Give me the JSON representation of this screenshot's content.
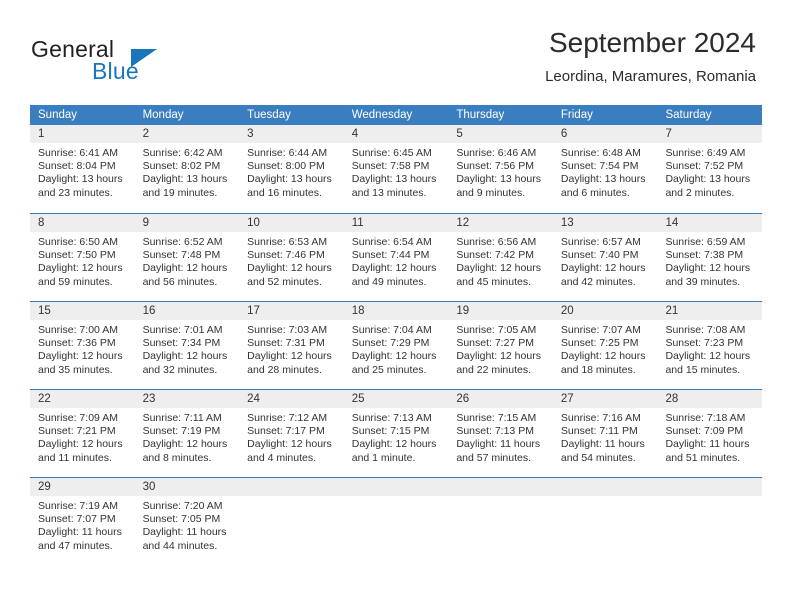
{
  "brand": {
    "name_part1": "General",
    "name_part2": "Blue",
    "logo_icon": "blue-triangle-icon"
  },
  "header": {
    "title": "September 2024",
    "subtitle": "Leordina, Maramures, Romania"
  },
  "colors": {
    "header_blue": "#3a7ebf",
    "brand_blue": "#1b75bb",
    "day_number_band": "#eeeeee",
    "text": "#333333"
  },
  "weekdays": [
    "Sunday",
    "Monday",
    "Tuesday",
    "Wednesday",
    "Thursday",
    "Friday",
    "Saturday"
  ],
  "weeks": [
    [
      {
        "day": "1",
        "sunrise": "Sunrise: 6:41 AM",
        "sunset": "Sunset: 8:04 PM",
        "daylight1": "Daylight: 13 hours",
        "daylight2": "and 23 minutes."
      },
      {
        "day": "2",
        "sunrise": "Sunrise: 6:42 AM",
        "sunset": "Sunset: 8:02 PM",
        "daylight1": "Daylight: 13 hours",
        "daylight2": "and 19 minutes."
      },
      {
        "day": "3",
        "sunrise": "Sunrise: 6:44 AM",
        "sunset": "Sunset: 8:00 PM",
        "daylight1": "Daylight: 13 hours",
        "daylight2": "and 16 minutes."
      },
      {
        "day": "4",
        "sunrise": "Sunrise: 6:45 AM",
        "sunset": "Sunset: 7:58 PM",
        "daylight1": "Daylight: 13 hours",
        "daylight2": "and 13 minutes."
      },
      {
        "day": "5",
        "sunrise": "Sunrise: 6:46 AM",
        "sunset": "Sunset: 7:56 PM",
        "daylight1": "Daylight: 13 hours",
        "daylight2": "and 9 minutes."
      },
      {
        "day": "6",
        "sunrise": "Sunrise: 6:48 AM",
        "sunset": "Sunset: 7:54 PM",
        "daylight1": "Daylight: 13 hours",
        "daylight2": "and 6 minutes."
      },
      {
        "day": "7",
        "sunrise": "Sunrise: 6:49 AM",
        "sunset": "Sunset: 7:52 PM",
        "daylight1": "Daylight: 13 hours",
        "daylight2": "and 2 minutes."
      }
    ],
    [
      {
        "day": "8",
        "sunrise": "Sunrise: 6:50 AM",
        "sunset": "Sunset: 7:50 PM",
        "daylight1": "Daylight: 12 hours",
        "daylight2": "and 59 minutes."
      },
      {
        "day": "9",
        "sunrise": "Sunrise: 6:52 AM",
        "sunset": "Sunset: 7:48 PM",
        "daylight1": "Daylight: 12 hours",
        "daylight2": "and 56 minutes."
      },
      {
        "day": "10",
        "sunrise": "Sunrise: 6:53 AM",
        "sunset": "Sunset: 7:46 PM",
        "daylight1": "Daylight: 12 hours",
        "daylight2": "and 52 minutes."
      },
      {
        "day": "11",
        "sunrise": "Sunrise: 6:54 AM",
        "sunset": "Sunset: 7:44 PM",
        "daylight1": "Daylight: 12 hours",
        "daylight2": "and 49 minutes."
      },
      {
        "day": "12",
        "sunrise": "Sunrise: 6:56 AM",
        "sunset": "Sunset: 7:42 PM",
        "daylight1": "Daylight: 12 hours",
        "daylight2": "and 45 minutes."
      },
      {
        "day": "13",
        "sunrise": "Sunrise: 6:57 AM",
        "sunset": "Sunset: 7:40 PM",
        "daylight1": "Daylight: 12 hours",
        "daylight2": "and 42 minutes."
      },
      {
        "day": "14",
        "sunrise": "Sunrise: 6:59 AM",
        "sunset": "Sunset: 7:38 PM",
        "daylight1": "Daylight: 12 hours",
        "daylight2": "and 39 minutes."
      }
    ],
    [
      {
        "day": "15",
        "sunrise": "Sunrise: 7:00 AM",
        "sunset": "Sunset: 7:36 PM",
        "daylight1": "Daylight: 12 hours",
        "daylight2": "and 35 minutes."
      },
      {
        "day": "16",
        "sunrise": "Sunrise: 7:01 AM",
        "sunset": "Sunset: 7:34 PM",
        "daylight1": "Daylight: 12 hours",
        "daylight2": "and 32 minutes."
      },
      {
        "day": "17",
        "sunrise": "Sunrise: 7:03 AM",
        "sunset": "Sunset: 7:31 PM",
        "daylight1": "Daylight: 12 hours",
        "daylight2": "and 28 minutes."
      },
      {
        "day": "18",
        "sunrise": "Sunrise: 7:04 AM",
        "sunset": "Sunset: 7:29 PM",
        "daylight1": "Daylight: 12 hours",
        "daylight2": "and 25 minutes."
      },
      {
        "day": "19",
        "sunrise": "Sunrise: 7:05 AM",
        "sunset": "Sunset: 7:27 PM",
        "daylight1": "Daylight: 12 hours",
        "daylight2": "and 22 minutes."
      },
      {
        "day": "20",
        "sunrise": "Sunrise: 7:07 AM",
        "sunset": "Sunset: 7:25 PM",
        "daylight1": "Daylight: 12 hours",
        "daylight2": "and 18 minutes."
      },
      {
        "day": "21",
        "sunrise": "Sunrise: 7:08 AM",
        "sunset": "Sunset: 7:23 PM",
        "daylight1": "Daylight: 12 hours",
        "daylight2": "and 15 minutes."
      }
    ],
    [
      {
        "day": "22",
        "sunrise": "Sunrise: 7:09 AM",
        "sunset": "Sunset: 7:21 PM",
        "daylight1": "Daylight: 12 hours",
        "daylight2": "and 11 minutes."
      },
      {
        "day": "23",
        "sunrise": "Sunrise: 7:11 AM",
        "sunset": "Sunset: 7:19 PM",
        "daylight1": "Daylight: 12 hours",
        "daylight2": "and 8 minutes."
      },
      {
        "day": "24",
        "sunrise": "Sunrise: 7:12 AM",
        "sunset": "Sunset: 7:17 PM",
        "daylight1": "Daylight: 12 hours",
        "daylight2": "and 4 minutes."
      },
      {
        "day": "25",
        "sunrise": "Sunrise: 7:13 AM",
        "sunset": "Sunset: 7:15 PM",
        "daylight1": "Daylight: 12 hours",
        "daylight2": "and 1 minute."
      },
      {
        "day": "26",
        "sunrise": "Sunrise: 7:15 AM",
        "sunset": "Sunset: 7:13 PM",
        "daylight1": "Daylight: 11 hours",
        "daylight2": "and 57 minutes."
      },
      {
        "day": "27",
        "sunrise": "Sunrise: 7:16 AM",
        "sunset": "Sunset: 7:11 PM",
        "daylight1": "Daylight: 11 hours",
        "daylight2": "and 54 minutes."
      },
      {
        "day": "28",
        "sunrise": "Sunrise: 7:18 AM",
        "sunset": "Sunset: 7:09 PM",
        "daylight1": "Daylight: 11 hours",
        "daylight2": "and 51 minutes."
      }
    ],
    [
      {
        "day": "29",
        "sunrise": "Sunrise: 7:19 AM",
        "sunset": "Sunset: 7:07 PM",
        "daylight1": "Daylight: 11 hours",
        "daylight2": "and 47 minutes."
      },
      {
        "day": "30",
        "sunrise": "Sunrise: 7:20 AM",
        "sunset": "Sunset: 7:05 PM",
        "daylight1": "Daylight: 11 hours",
        "daylight2": "and 44 minutes."
      },
      {
        "day": "",
        "sunrise": "",
        "sunset": "",
        "daylight1": "",
        "daylight2": ""
      },
      {
        "day": "",
        "sunrise": "",
        "sunset": "",
        "daylight1": "",
        "daylight2": ""
      },
      {
        "day": "",
        "sunrise": "",
        "sunset": "",
        "daylight1": "",
        "daylight2": ""
      },
      {
        "day": "",
        "sunrise": "",
        "sunset": "",
        "daylight1": "",
        "daylight2": ""
      },
      {
        "day": "",
        "sunrise": "",
        "sunset": "",
        "daylight1": "",
        "daylight2": ""
      }
    ]
  ]
}
